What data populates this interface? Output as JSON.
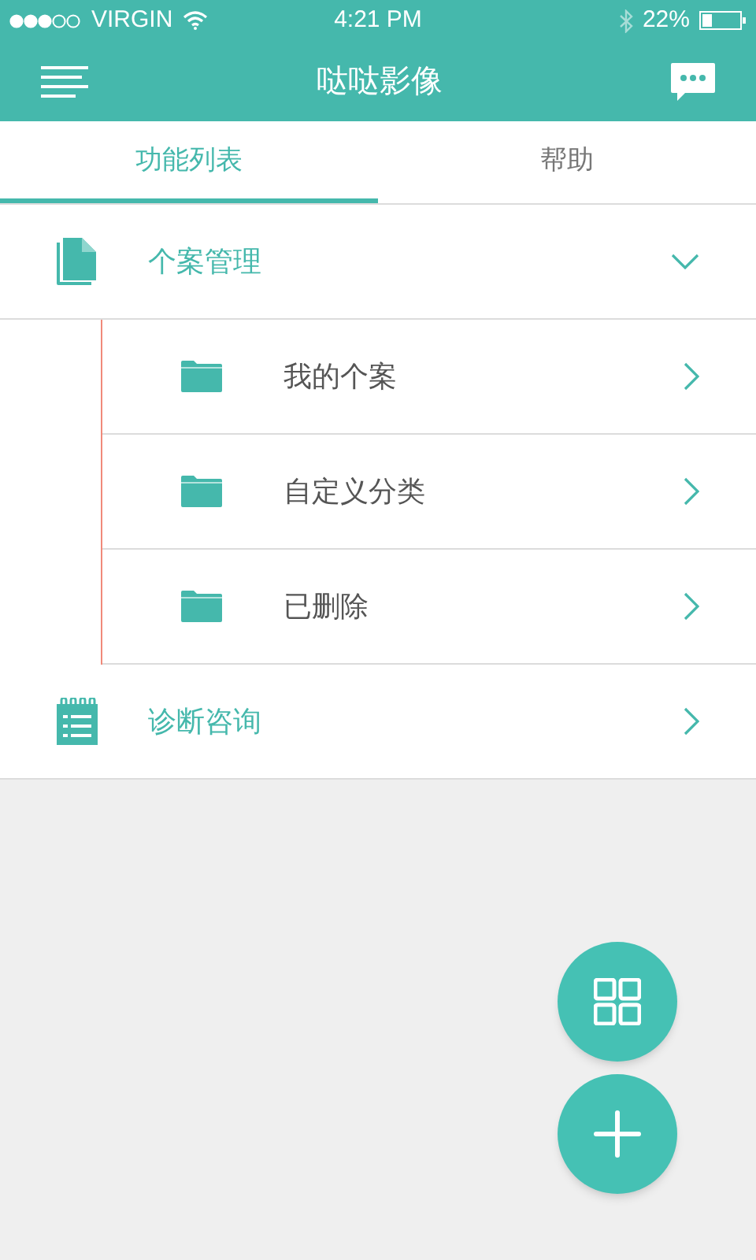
{
  "status_bar": {
    "carrier": "VIRGIN",
    "time": "4:21 PM",
    "battery": "22%"
  },
  "header": {
    "title": "哒哒影像"
  },
  "tabs": [
    {
      "label": "功能列表",
      "selected": true
    },
    {
      "label": "帮助",
      "selected": false
    }
  ],
  "menu": [
    {
      "kind": "group",
      "label": "个案管理",
      "expanded": true,
      "children": [
        {
          "label": "我的个案"
        },
        {
          "label": "自定义分类"
        },
        {
          "label": "已删除"
        }
      ]
    },
    {
      "kind": "item",
      "label": "诊断咨询"
    }
  ]
}
